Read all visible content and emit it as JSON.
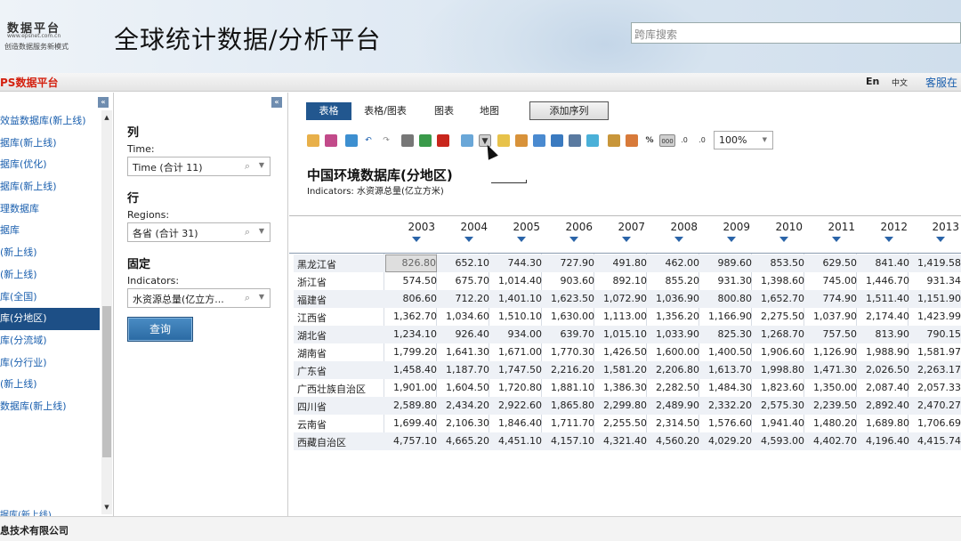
{
  "header": {
    "logo_title": "数据平台",
    "logo_url": "www.epsnet.com.cn",
    "logo_slogan": "创造数据服务新模式",
    "page_title": "全球统计数据/分析平台",
    "search_placeholder": "跨库搜索"
  },
  "topbar": {
    "brand": "PS数据平台",
    "lang_en": "En",
    "lang_zh": "中文",
    "service": "客服在"
  },
  "sidebar": {
    "items": [
      {
        "label": "效益数据库(新上线)"
      },
      {
        "label": "据库(新上线)"
      },
      {
        "label": "据库(优化)"
      },
      {
        "label": "据库(新上线)"
      },
      {
        "label": "理数据库"
      },
      {
        "label": "据库"
      },
      {
        "label": "(新上线)"
      },
      {
        "label": "(新上线)"
      },
      {
        "label": "库(全国)"
      },
      {
        "label": "库(分地区)"
      },
      {
        "label": "库(分流域)"
      },
      {
        "label": "库(分行业)"
      },
      {
        "label": "(新上线)"
      },
      {
        "label": "数据库(新上线)"
      }
    ],
    "last_item": "据库(新上线)"
  },
  "panel": {
    "col_title": "列",
    "time_label": "Time:",
    "time_value": "Time (合计 11)",
    "row_title": "行",
    "regions_label": "Regions:",
    "regions_value": "各省 (合计 31)",
    "fixed_title": "固定",
    "indicators_label": "Indicators:",
    "indicators_value": "水资源总量(亿立方...",
    "query_label": "查询"
  },
  "main": {
    "tabs": [
      "表格",
      "表格/图表",
      "图表",
      "地图"
    ],
    "add_series": "添加序列",
    "zoom": "100%",
    "toolbar_text": {
      "percent": "%",
      "thousand": "000",
      "inc": ".0",
      "dec": ".0"
    },
    "title": "中国环境数据库(分地区)",
    "indicators": "Indicators: 水资源总量(亿立方米)"
  },
  "table": {
    "years": [
      "2003",
      "2004",
      "2005",
      "2006",
      "2007",
      "2008",
      "2009",
      "2010",
      "2011",
      "2012",
      "2013"
    ],
    "rows": [
      {
        "name": "黑龙江省",
        "values": [
          "826.80",
          "652.10",
          "744.30",
          "727.90",
          "491.80",
          "462.00",
          "989.60",
          "853.50",
          "629.50",
          "841.40",
          "1,419.58"
        ]
      },
      {
        "name": "浙江省",
        "values": [
          "574.50",
          "675.70",
          "1,014.40",
          "903.60",
          "892.10",
          "855.20",
          "931.30",
          "1,398.60",
          "745.00",
          "1,446.70",
          "931.34"
        ]
      },
      {
        "name": "福建省",
        "values": [
          "806.60",
          "712.20",
          "1,401.10",
          "1,623.50",
          "1,072.90",
          "1,036.90",
          "800.80",
          "1,652.70",
          "774.90",
          "1,511.40",
          "1,151.90"
        ]
      },
      {
        "name": "江西省",
        "values": [
          "1,362.70",
          "1,034.60",
          "1,510.10",
          "1,630.00",
          "1,113.00",
          "1,356.20",
          "1,166.90",
          "2,275.50",
          "1,037.90",
          "2,174.40",
          "1,423.99"
        ]
      },
      {
        "name": "湖北省",
        "values": [
          "1,234.10",
          "926.40",
          "934.00",
          "639.70",
          "1,015.10",
          "1,033.90",
          "825.30",
          "1,268.70",
          "757.50",
          "813.90",
          "790.15"
        ]
      },
      {
        "name": "湖南省",
        "values": [
          "1,799.20",
          "1,641.30",
          "1,671.00",
          "1,770.30",
          "1,426.50",
          "1,600.00",
          "1,400.50",
          "1,906.60",
          "1,126.90",
          "1,988.90",
          "1,581.97"
        ]
      },
      {
        "name": "广东省",
        "values": [
          "1,458.40",
          "1,187.70",
          "1,747.50",
          "2,216.20",
          "1,581.20",
          "2,206.80",
          "1,613.70",
          "1,998.80",
          "1,471.30",
          "2,026.50",
          "2,263.17"
        ]
      },
      {
        "name": "广西壮族自治区",
        "values": [
          "1,901.00",
          "1,604.50",
          "1,720.80",
          "1,881.10",
          "1,386.30",
          "2,282.50",
          "1,484.30",
          "1,823.60",
          "1,350.00",
          "2,087.40",
          "2,057.33"
        ]
      },
      {
        "name": "四川省",
        "values": [
          "2,589.80",
          "2,434.20",
          "2,922.60",
          "1,865.80",
          "2,299.80",
          "2,489.90",
          "2,332.20",
          "2,575.30",
          "2,239.50",
          "2,892.40",
          "2,470.27"
        ]
      },
      {
        "name": "云南省",
        "values": [
          "1,699.40",
          "2,106.30",
          "1,846.40",
          "1,711.70",
          "2,255.50",
          "2,314.50",
          "1,576.60",
          "1,941.40",
          "1,480.20",
          "1,689.80",
          "1,706.69"
        ]
      },
      {
        "name": "西藏自治区",
        "values": [
          "4,757.10",
          "4,665.20",
          "4,451.10",
          "4,157.10",
          "4,321.40",
          "4,560.20",
          "4,029.20",
          "4,593.00",
          "4,402.70",
          "4,196.40",
          "4,415.74"
        ]
      }
    ]
  },
  "footer": {
    "company": "息技术有限公司"
  }
}
